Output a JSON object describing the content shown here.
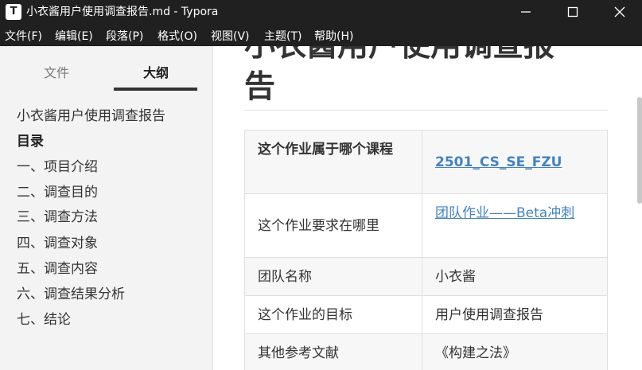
{
  "window": {
    "app_icon_letter": "T",
    "title": "小衣酱用户使用调查报告.md - Typora"
  },
  "menu": [
    "文件(F)",
    "编辑(E)",
    "段落(P)",
    "格式(O)",
    "视图(V)",
    "主题(T)",
    "帮助(H)"
  ],
  "sidebar": {
    "tabs": [
      "文件",
      "大纲"
    ],
    "active_tab": "大纲",
    "outline": [
      "小衣酱用户使用调查报告",
      "目录",
      "一、项目介绍",
      "二、调查目的",
      "三、调查方法",
      "四、调查对象",
      "五、调查内容",
      "六、调查结果分析",
      "七、结论"
    ]
  },
  "document": {
    "heading_line1": "小衣酱用户使用调查报",
    "heading_line2": "告",
    "table": [
      [
        "这个作业属于哪个课程",
        "2501_CS_SE_FZU"
      ],
      [
        "这个作业要求在哪里",
        "团队作业——Beta冲刺"
      ],
      [
        "团队名称",
        "小衣酱"
      ],
      [
        "这个作业的目标",
        "用户使用调查报告"
      ],
      [
        "其他参考文献",
        "《构建之法》"
      ]
    ]
  },
  "colors": {
    "titlebar": "#202020",
    "sidebar": "#f3f3f3",
    "link": "#4183c4",
    "table_alt_row": "#f7f7f7"
  }
}
